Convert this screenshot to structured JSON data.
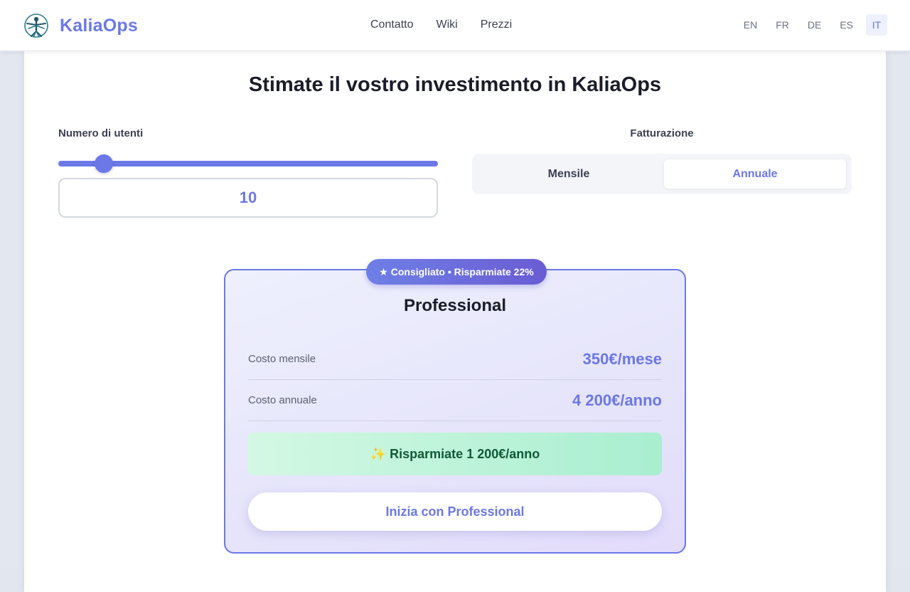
{
  "header": {
    "logo_text": "KaliaOps",
    "logo_icon": "vitruvian-figure-icon",
    "nav": [
      "Contatto",
      "Wiki",
      "Prezzi"
    ],
    "languages": [
      "EN",
      "FR",
      "DE",
      "ES",
      "IT"
    ],
    "active_language": "IT"
  },
  "calculator": {
    "title": "Stimate il vostro investimento in KaliaOps",
    "users_label": "Numero di utenti",
    "users_value": "10",
    "slider_fraction": 0.1,
    "billing_label": "Fatturazione",
    "billing_options": [
      "Mensile",
      "Annuale"
    ],
    "billing_selected": "Annuale"
  },
  "plan": {
    "badge": "★ Consigliato • Risparmiate 22%",
    "name": "Professional",
    "monthly_label": "Costo mensile",
    "monthly_value": "350€/mese",
    "annual_label": "Costo annuale",
    "annual_value": "4 200€/anno",
    "savings": "✨ Risparmiate 1 200€/anno",
    "cta": "Inizia con Professional"
  },
  "colors": {
    "accent": "#6b78e6",
    "savings_bg": "#c5f5dd",
    "savings_text": "#0f5a36"
  }
}
